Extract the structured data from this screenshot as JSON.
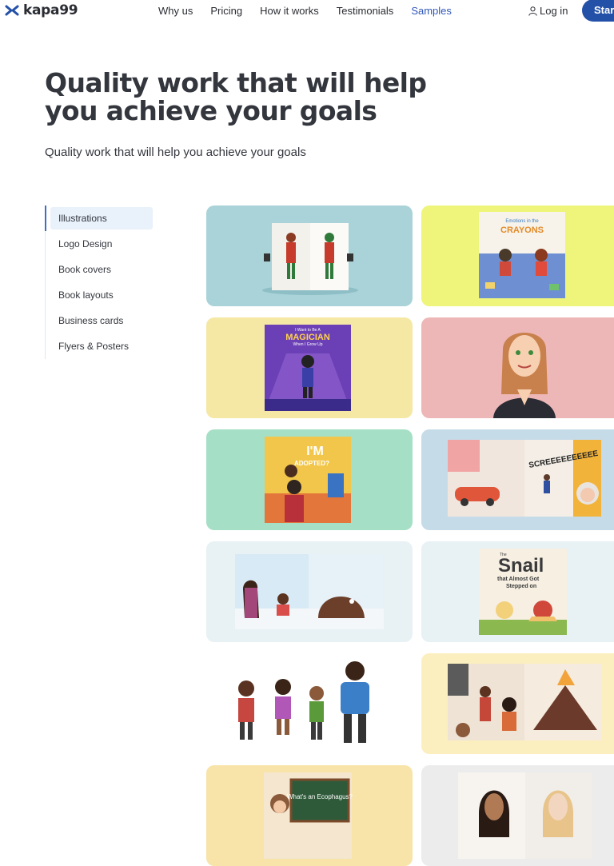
{
  "brand": {
    "name": "kapa99",
    "accent": "#2451a8",
    "active_link": "#3057b8"
  },
  "nav": {
    "links": [
      "Why us",
      "Pricing",
      "How it works",
      "Testimonials",
      "Samples"
    ],
    "active": "Samples",
    "login_label": "Log in",
    "cta_label": "Start"
  },
  "hero": {
    "title": "Quality work that will help you achieve your goals",
    "subtitle": "Quality work that will help you achieve your goals"
  },
  "categories": {
    "items": [
      "Illustrations",
      "Logo Design",
      "Book covers",
      "Book layouts",
      "Business cards",
      "Flyers & Posters"
    ],
    "selected": "Illustrations"
  },
  "samples": {
    "card_texts": {
      "crayons_title_1": "Emotions in the",
      "crayons_title_2": "CRAYONS",
      "magician_line_1": "I Want to Be A",
      "magician_line_2": "MAGICIAN",
      "magician_line_3": "When I Grow Up",
      "adopted_1": "I'M",
      "adopted_2": "ADOPTED?",
      "sneeze": "SCREEEEEEEEEE",
      "snail_1": "The",
      "snail_2": "Snail",
      "snail_3": "that Almost Got",
      "snail_4": "Stepped on",
      "chalk": "What's an Ecophagus?"
    },
    "backgrounds": [
      "#a9d3d9",
      "#eef57a",
      "#f5e7a4",
      "#eeb7b7",
      "#a5dfc6",
      "#c6dbe8",
      "#e8f1f4",
      "#e8f1f4",
      "#ffffff",
      "#fcefbf",
      "#f8e3a8",
      "#ececec"
    ]
  }
}
